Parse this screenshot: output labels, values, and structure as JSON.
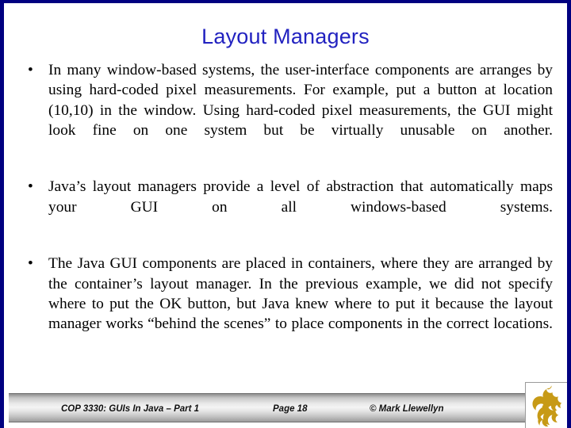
{
  "slide": {
    "title": "Layout Managers",
    "title_color": "#2222c0",
    "border_color": "#000080",
    "background_color": "#ffffff",
    "bullet_marker": "•",
    "bullets": [
      {
        "text": "In many window-based systems, the user-interface components are arranges by using hard-coded pixel measurements.  For example, put a button at location (10,10) in the window.   Using hard-coded pixel measurements, the GUI might look fine on one system but be virtually unusable on another."
      },
      {
        "text": "Java’s layout managers provide a level of abstraction that automatically maps your GUI on all windows-based systems."
      },
      {
        "text": "The Java GUI components are placed in containers, where they are arranged by the container’s layout manager.  In the previous example, we did not specify where to put the OK button, but Java knew where to put it because the layout manager works “behind the scenes” to place components in the correct locations."
      }
    ]
  },
  "footer": {
    "course": "COP 3330:  GUIs In Java – Part 1",
    "page": "Page 18",
    "copyright": "© Mark Llewellyn",
    "logo_name": "ucf-pegasus-logo",
    "logo_color": "#c79a16"
  }
}
